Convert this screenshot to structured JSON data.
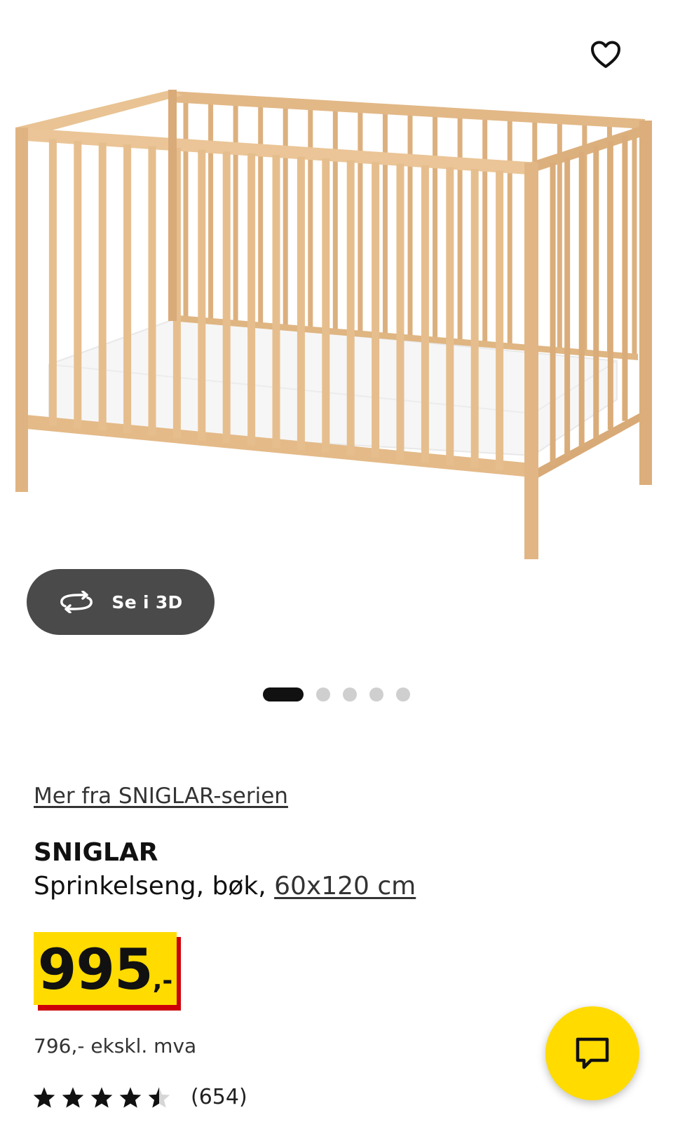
{
  "colors": {
    "brand_yellow": "#ffdb00",
    "price_accent_red": "#cc0008",
    "pill_background": "#4a4a4a",
    "wood": "#e7c295"
  },
  "favorite": {
    "icon": "heart-outline-icon"
  },
  "view_3d": {
    "icon": "rotate-3d-icon",
    "label": "Se i 3D"
  },
  "carousel": {
    "total": 5,
    "active_index": 0
  },
  "series_link": "Mer fra SNIGLAR-serien",
  "product": {
    "name": "SNIGLAR",
    "description": "Sprinkelseng, bøk, ",
    "size_link": "60x120 cm"
  },
  "price": {
    "amount": "995",
    "suffix": ",-",
    "ex_vat": "796,- ekskl. mva"
  },
  "rating": {
    "value": 4.5,
    "max": 5,
    "count": "(654)"
  },
  "chat": {
    "icon": "chat-bubble-icon"
  }
}
